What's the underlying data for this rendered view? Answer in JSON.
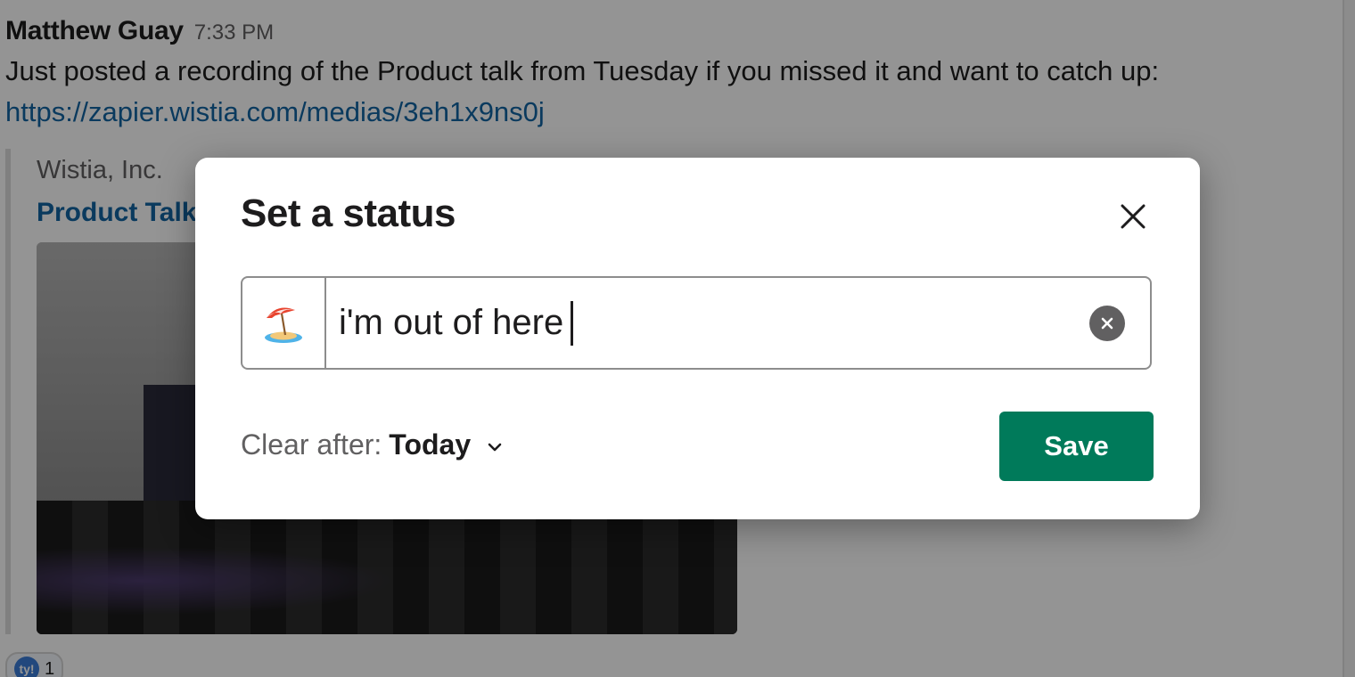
{
  "message": {
    "author": "Matthew Guay",
    "time": "7:33 PM",
    "text": "Just posted a recording of the Product talk from Tuesday if you missed it and want to catch up:",
    "link": "https://zapier.wistia.com/medias/3eh1x9ns0j",
    "unfurl": {
      "site": "Wistia, Inc.",
      "title": "Product Talk"
    },
    "reaction": {
      "emoji": "ty!",
      "count": "1"
    }
  },
  "modal": {
    "title": "Set a status",
    "status_emoji": "beach-with-umbrella-emoji",
    "status_text": "i'm out of here",
    "clear_after_label": "Clear after:",
    "clear_after_value": "Today",
    "save_label": "Save"
  },
  "colors": {
    "save_button": "#007a5a",
    "link": "#1264a3",
    "overlay": "rgba(0,0,0,0.42)"
  }
}
